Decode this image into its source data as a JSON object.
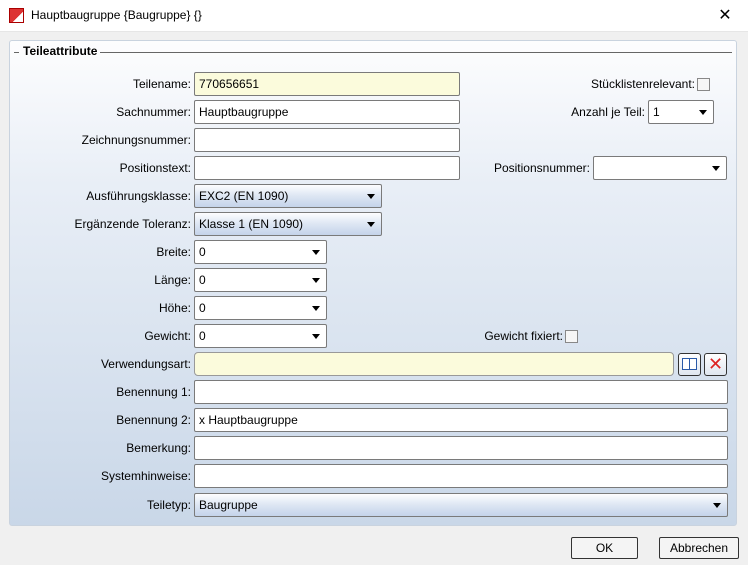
{
  "window": {
    "title": "Hauptbaugruppe {Baugruppe} {}",
    "close": "✕"
  },
  "group": {
    "legend": "Teileattribute"
  },
  "fields": {
    "teilename": {
      "label": "Teilename:",
      "value": "770656651"
    },
    "sachnummer": {
      "label": "Sachnummer:",
      "value": "Hauptbaugruppe"
    },
    "zeichnungsnummer": {
      "label": "Zeichnungsnummer:",
      "value": ""
    },
    "positionstext": {
      "label": "Positionstext:",
      "value": ""
    },
    "ausfuehrungsklasse": {
      "label": "Ausführungsklasse:",
      "value": "EXC2 (EN 1090)"
    },
    "toleranz": {
      "label": "Ergänzende Toleranz:",
      "value": "Klasse 1 (EN 1090)"
    },
    "breite": {
      "label": "Breite:",
      "value": "0"
    },
    "laenge": {
      "label": "Länge:",
      "value": "0"
    },
    "hoehe": {
      "label": "Höhe:",
      "value": "0"
    },
    "gewicht": {
      "label": "Gewicht:",
      "value": "0"
    },
    "verwendungsart": {
      "label": "Verwendungsart:",
      "value": ""
    },
    "benennung1": {
      "label": "Benennung 1:",
      "value": ""
    },
    "benennung2": {
      "label": "Benennung 2:",
      "value": "x Hauptbaugruppe"
    },
    "bemerkung": {
      "label": "Bemerkung:",
      "value": ""
    },
    "systemhinweise": {
      "label": "Systemhinweise:",
      "value": ""
    },
    "teiletyp": {
      "label": "Teiletyp:",
      "value": "Baugruppe"
    },
    "stuecklistenrelevant": {
      "label": "Stücklistenrelevant:",
      "checked": false
    },
    "anzahl": {
      "label": "Anzahl je Teil:",
      "value": "1"
    },
    "positionsnummer": {
      "label": "Positionsnummer:",
      "value": ""
    },
    "gewicht_fixiert": {
      "label": "Gewicht fixiert:",
      "checked": false
    }
  },
  "buttons": {
    "ok": "OK",
    "cancel": "Abbrechen"
  }
}
